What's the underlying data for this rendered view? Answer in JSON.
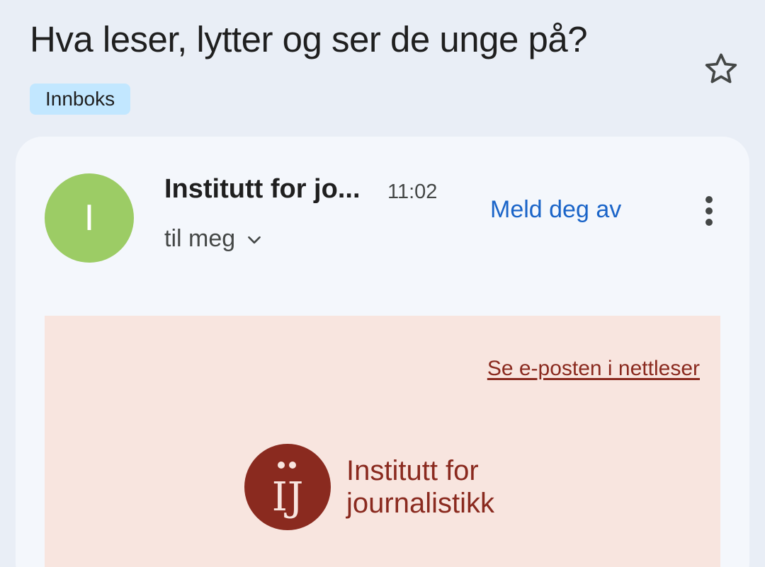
{
  "message": {
    "subject": "Hva leser, lytter og ser de unge på?",
    "label": "Innboks",
    "star_icon": "star-outline-icon"
  },
  "header": {
    "avatar_letter": "I",
    "avatar_color": "#9ccc65",
    "sender": "Institutt for jo...",
    "time": "11:02",
    "recipient": "til meg",
    "unsubscribe": "Meld deg av"
  },
  "body": {
    "view_in_browser": "Se e-posten i nettleser",
    "logo_line1": "Institutt for",
    "logo_line2": "journalistikk",
    "logo_mark": "ïJ",
    "brand_color": "#8a2a1f",
    "background": "#f8e5df"
  }
}
